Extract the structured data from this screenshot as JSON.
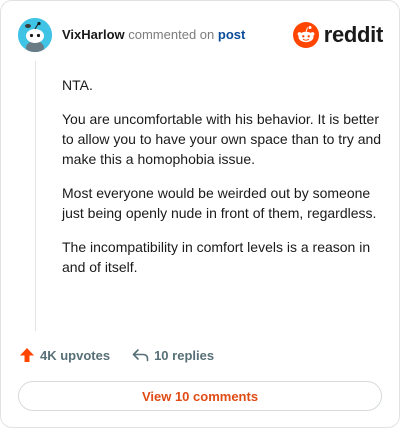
{
  "comment": {
    "username": "VixHarlow",
    "action_text": "commented on",
    "target_link": "post",
    "paragraphs": [
      "NTA.",
      "You are uncomfortable with his behavior. It is better to allow you to have your own space than to try and make this a homophobia issue.",
      "Most everyone would be weirded out by someone just being openly nude in front of them, regardless.",
      "The incompatibility in comfort levels is a reason in and of itself."
    ]
  },
  "brand": {
    "logo_text": "reddit",
    "accent_color": "#ff4500"
  },
  "actions": {
    "upvotes": "4K upvotes",
    "replies": "10 replies"
  },
  "footer": {
    "view_comments_label": "View 10 comments"
  }
}
